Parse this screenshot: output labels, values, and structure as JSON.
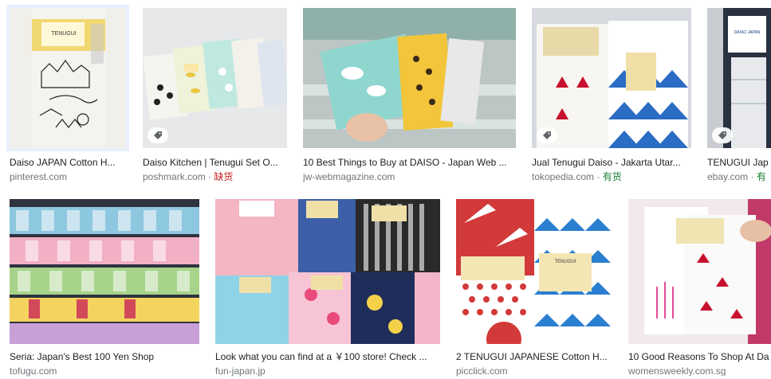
{
  "results": [
    {
      "title": "Daiso JAPAN Cotton H...",
      "source": "pinterest.com",
      "stock": "",
      "has_tag": false
    },
    {
      "title": "Daiso Kitchen | Tenugui Set O...",
      "source": "poshmark.com",
      "stock": "缺货",
      "has_tag": true
    },
    {
      "title": "10 Best Things to Buy at DAISO - Japan Web ...",
      "source": "jw-webmagazine.com",
      "stock": "",
      "has_tag": false
    },
    {
      "title": "Jual Tenugui Daiso - Jakarta Utar...",
      "source": "tokopedia.com",
      "stock": "有货",
      "has_tag": true
    },
    {
      "title": "TENUGUI Jap",
      "source": "ebay.com",
      "stock": "有",
      "has_tag": true
    },
    {
      "title": "Seria: Japan's Best 100 Yen Shop",
      "source": "tofugu.com",
      "stock": "",
      "has_tag": false
    },
    {
      "title": "Look what you can find at a ￥100 store! Check ...",
      "source": "fun-japan.jp",
      "stock": "",
      "has_tag": false
    },
    {
      "title": "2 TENUGUI JAPANESE Cotton H...",
      "source": "picclick.com",
      "stock": "",
      "has_tag": false
    },
    {
      "title": "10 Good Reasons To Shop At Da",
      "source": "womensweekly.com.sg",
      "stock": "",
      "has_tag": false
    }
  ],
  "package_text": {
    "daiso_jp": "DAISO JAPAN",
    "tenugui": "TENUGUI"
  },
  "colors": {
    "title": "#202124",
    "source": "#70757a",
    "out_of_stock": "#c5221f",
    "in_stock": "#188038"
  }
}
